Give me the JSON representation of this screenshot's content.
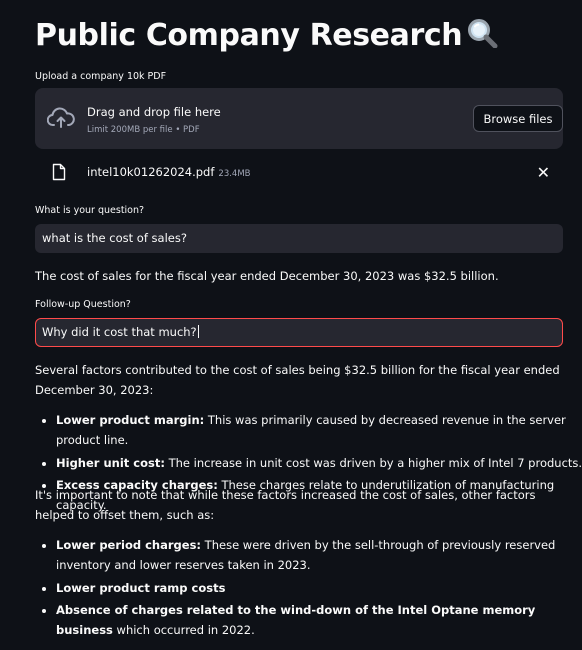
{
  "header": {
    "title": "Public Company Research",
    "title_icon": "magnifying-glass-icon"
  },
  "upload": {
    "label": "Upload a company 10k PDF",
    "dropzone_text": "Drag and drop file here",
    "dropzone_limit": "Limit 200MB per file • PDF",
    "browse_label": "Browse files",
    "icon": "cloud-upload-icon",
    "file": {
      "name": "intel10k01262024.pdf",
      "size": "23.4MB",
      "icon": "file-icon",
      "remove_label": "✕"
    }
  },
  "question": {
    "label": "What is your question?",
    "value": "what is the cost of sales?"
  },
  "answer": {
    "text": "The cost of sales for the fiscal year ended December 30, 2023 was $32.5 billion."
  },
  "followup": {
    "label": "Follow-up Question?",
    "value": "Why did it cost that much?"
  },
  "response": {
    "intro": "Several factors contributed to the cost of sales being $32.5 billion for the fiscal year ended December 30, 2023:",
    "factors": [
      {
        "bold": "Lower product margin:",
        "text": " This was primarily caused by decreased revenue in the server product line."
      },
      {
        "bold": "Higher unit cost:",
        "text": " The increase in unit cost was driven by a higher mix of Intel 7 products."
      },
      {
        "bold": "Excess capacity charges:",
        "text": " These charges relate to underutilization of manufacturing capacity."
      }
    ],
    "note": "It's important to note that while these factors increased the cost of sales, other factors helped to offset them, such as:",
    "offsets": [
      {
        "bold": "Lower period charges:",
        "text": " These were driven by the sell-through of previously reserved inventory and lower reserves taken in 2023."
      },
      {
        "bold": "Lower product ramp costs",
        "text": ""
      },
      {
        "bold": "Absence of charges related to the wind-down of the Intel Optane memory business",
        "text": " which occurred in 2022."
      }
    ]
  },
  "colors": {
    "background": "#0e1117",
    "surface": "#262730",
    "focus_border": "#ff4b4b",
    "muted_text": "#a3a8b8"
  }
}
